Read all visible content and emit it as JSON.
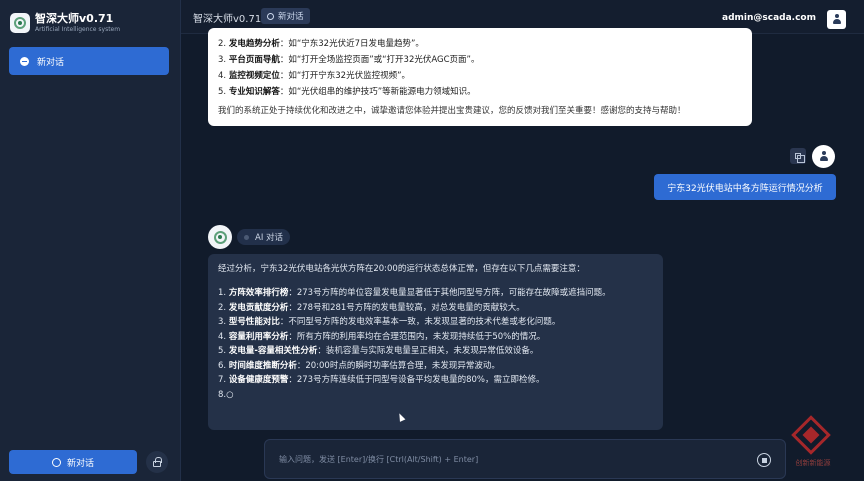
{
  "sidebar": {
    "app_name": "智深大师v0.71",
    "app_subtitle": "Artificial Intelligence system",
    "chat_item": "新对话",
    "new_chat_button": "新对话"
  },
  "header": {
    "title": "智深大师v0.71",
    "badge": "新对话",
    "user": "admin@scada.com"
  },
  "welcome": {
    "items": [
      {
        "num": "2.",
        "key": "发电趋势分析",
        "text": "：如“宁东32光伏近7日发电量趋势”。"
      },
      {
        "num": "3.",
        "key": "平台页面导航",
        "text": "：如“打开全场监控页面”或“打开32光伏AGC页面”。"
      },
      {
        "num": "4.",
        "key": "监控视频定位",
        "text": "：如“打开宁东32光伏监控视频”。"
      },
      {
        "num": "5.",
        "key": "专业知识解答",
        "text": "：如“光伏组串的维护技巧”等新能源电力领域知识。"
      }
    ],
    "note": "我们的系统正处于持续优化和改进之中，诚挚邀请您体验并提出宝贵建议，您的反馈对我们至关重要！感谢您的支持与帮助！"
  },
  "user_message": "宁东32光伏电站中各方阵运行情况分析",
  "ai": {
    "tag": "AI 对话",
    "intro": "经过分析，宁东32光伏电站各光伏方阵在20:00的运行状态总体正常，但存在以下几点需要注意：",
    "items": [
      {
        "num": "1.",
        "key": "方阵效率排行榜",
        "text": "：273号方阵的单位容量发电量显著低于其他同型号方阵，可能存在故障或遮挡问题。"
      },
      {
        "num": "2.",
        "key": "发电贡献度分析",
        "text": "：278号和281号方阵的发电量较高，对总发电量的贡献较大。"
      },
      {
        "num": "3.",
        "key": "型号性能对比",
        "text": "：不同型号方阵的发电效率基本一致，未发现显著的技术代差或老化问题。"
      },
      {
        "num": "4.",
        "key": "容量利用率分析",
        "text": "：所有方阵的利用率均在合理范围内，未发现持续低于50%的情况。"
      },
      {
        "num": "5.",
        "key": "发电量-容量相关性分析",
        "text": "：装机容量与实际发电量呈正相关，未发现异常低效设备。"
      },
      {
        "num": "6.",
        "key": "时间维度推断分析",
        "text": "：20:00时点的瞬时功率估算合理，未发现异常波动。"
      },
      {
        "num": "7.",
        "key": "设备健康度预警",
        "text": "：273号方阵连续低于同型号设备平均发电量的80%，需立即检修。"
      },
      {
        "num": "8.",
        "key": "",
        "text": "○"
      }
    ]
  },
  "input": {
    "placeholder": "输入问题，发送 [Enter]/换行 [Ctrl(Alt/Shift) + Enter]"
  },
  "watermark": {
    "text": "创新新能源"
  },
  "colors": {
    "accent": "#2e6bd3",
    "background": "#111b2b",
    "sidebar": "#1a2538",
    "ai_bubble": "#243148"
  }
}
